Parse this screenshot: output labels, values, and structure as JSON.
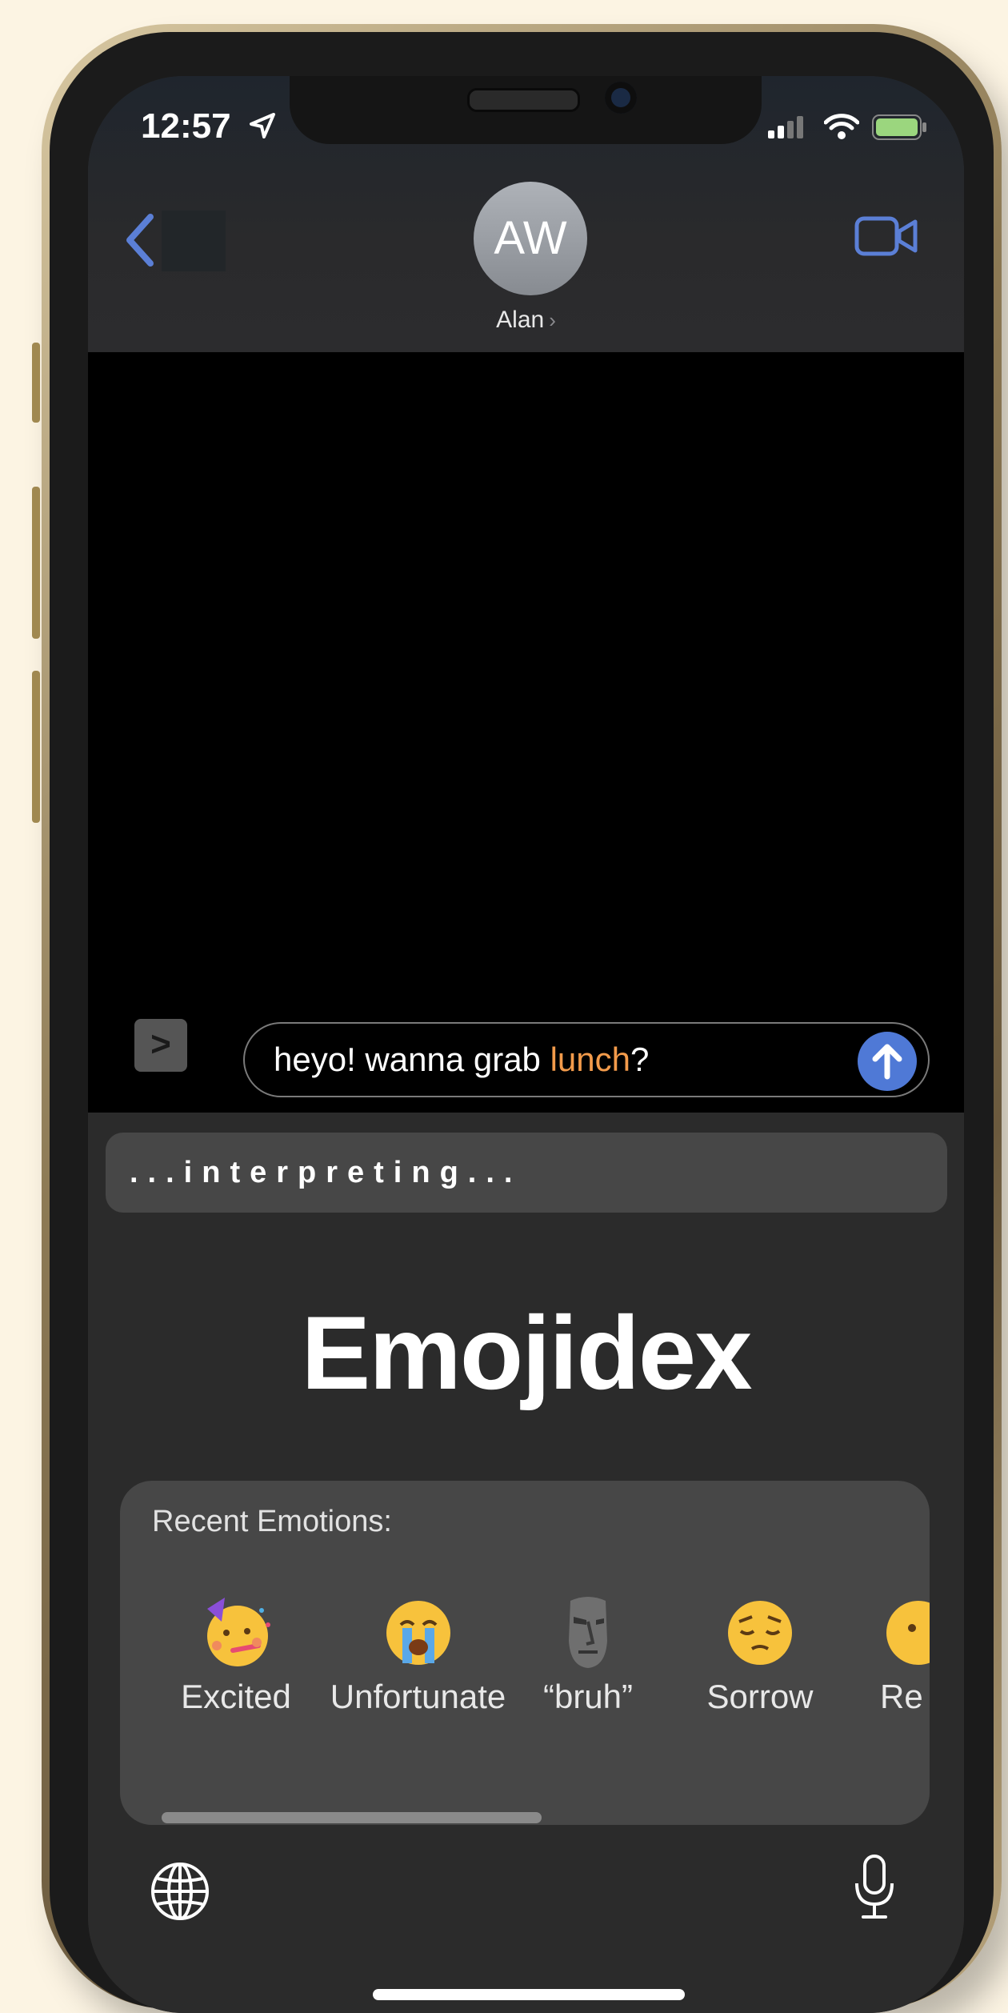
{
  "status_bar": {
    "time": "12:57"
  },
  "header": {
    "avatar_initials": "AW",
    "contact_name": "Alan",
    "contact_chevron": "›"
  },
  "compose": {
    "expand_label": ">",
    "message_before": "heyo! wanna grab ",
    "message_highlight": "lunch",
    "message_after": "?",
    "highlight_color": "#f39b4b"
  },
  "keyboard": {
    "status_text": "...interpreting...",
    "brand_title": "Emojidex",
    "recent_title": "Recent Emotions:",
    "emotions": [
      {
        "icon": "partying-face-icon",
        "label": "Excited"
      },
      {
        "icon": "loudly-crying-face-icon",
        "label": "Unfortunate"
      },
      {
        "icon": "moai-icon",
        "label": "“bruh”"
      },
      {
        "icon": "pensive-face-icon",
        "label": "Sorrow"
      },
      {
        "icon": "partial-face-icon",
        "label": "Re"
      }
    ]
  },
  "colors": {
    "send_button": "#4f79d6",
    "accent_blue": "#5b7fd6",
    "battery": "#9bd67e"
  }
}
